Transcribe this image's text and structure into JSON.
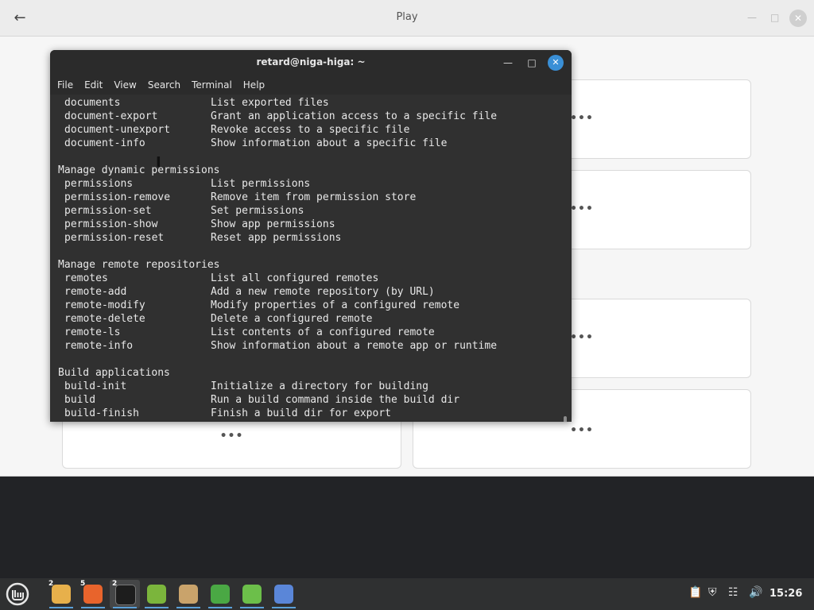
{
  "background_window": {
    "title": "Play",
    "back_icon": "arrow-left-icon",
    "card_more_label": "•••"
  },
  "terminal": {
    "title": "retard@niga-higa: ~",
    "menu": [
      "File",
      "Edit",
      "View",
      "Search",
      "Terminal",
      "Help"
    ],
    "lines": [
      {
        "cmd": "documents",
        "desc": "List exported files"
      },
      {
        "cmd": "document-export",
        "desc": "Grant an application access to a specific file"
      },
      {
        "cmd": "document-unexport",
        "desc": "Revoke access to a specific file"
      },
      {
        "cmd": "document-info",
        "desc": "Show information about a specific file"
      },
      {
        "heading": ""
      },
      {
        "heading": "Manage dynamic permissions"
      },
      {
        "cmd": "permissions",
        "desc": "List permissions"
      },
      {
        "cmd": "permission-remove",
        "desc": "Remove item from permission store"
      },
      {
        "cmd": "permission-set",
        "desc": "Set permissions"
      },
      {
        "cmd": "permission-show",
        "desc": "Show app permissions"
      },
      {
        "cmd": "permission-reset",
        "desc": "Reset app permissions"
      },
      {
        "heading": ""
      },
      {
        "heading": "Manage remote repositories"
      },
      {
        "cmd": "remotes",
        "desc": "List all configured remotes"
      },
      {
        "cmd": "remote-add",
        "desc": "Add a new remote repository (by URL)"
      },
      {
        "cmd": "remote-modify",
        "desc": "Modify properties of a configured remote"
      },
      {
        "cmd": "remote-delete",
        "desc": "Delete a configured remote"
      },
      {
        "cmd": "remote-ls",
        "desc": "List contents of a configured remote"
      },
      {
        "cmd": "remote-info",
        "desc": "Show information about a remote app or runtime"
      },
      {
        "heading": ""
      },
      {
        "heading": "Build applications"
      },
      {
        "cmd": "build-init",
        "desc": "Initialize a directory for building"
      },
      {
        "cmd": "build",
        "desc": "Run a build command inside the build dir"
      },
      {
        "cmd": "build-finish",
        "desc": "Finish a build dir for export"
      }
    ]
  },
  "taskbar": {
    "menu_icon": "linux-mint-menu-icon",
    "apps": [
      {
        "name": "files-icon",
        "badge": "2",
        "color": "#e7b04b"
      },
      {
        "name": "firefox-icon",
        "badge": "5",
        "color": "#e8642c"
      },
      {
        "name": "terminal-icon",
        "badge": "2",
        "color": "#1d1d1d"
      },
      {
        "name": "mintinstall-icon",
        "badge": "",
        "color": "#7bb53c"
      },
      {
        "name": "archive-icon",
        "badge": "",
        "color": "#c9a36b"
      },
      {
        "name": "shield-icon",
        "badge": "",
        "color": "#4aa844"
      },
      {
        "name": "spreadsheet-icon",
        "badge": "",
        "color": "#6cbf4a"
      },
      {
        "name": "network-app-icon",
        "badge": "",
        "color": "#5a86d8"
      }
    ],
    "tray": [
      "clipboard-icon",
      "security-shield-icon",
      "network-icon",
      "volume-icon"
    ],
    "clock": "15:26"
  }
}
